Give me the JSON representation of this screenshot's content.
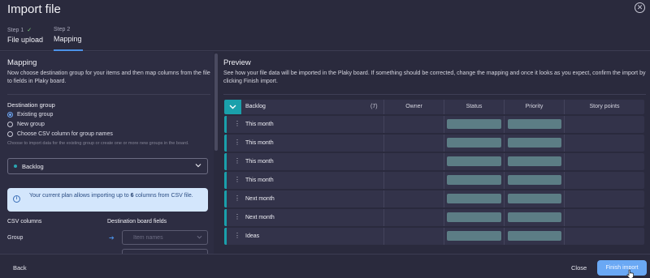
{
  "header": {
    "title": "Import file",
    "close_icon": "close-circle-icon"
  },
  "steps": [
    {
      "num": "Step 1",
      "label": "File upload",
      "done": true
    },
    {
      "num": "Step 2",
      "label": "Mapping",
      "active": true
    }
  ],
  "left": {
    "title": "Mapping",
    "description": "Now choose destination group for your items and then map columns from the file to fields in Plaky board.",
    "destination_title": "Destination group",
    "options": [
      {
        "label": "Existing group",
        "selected": true
      },
      {
        "label": "New group",
        "selected": false
      },
      {
        "label": "Choose CSV column for group names",
        "selected": false
      }
    ],
    "hint": "Choose to import data for the existing group or create one or more new groups in the board.",
    "selected_group": "Backlog",
    "info": {
      "prefix": "Your current plan allows importing up to ",
      "count": "6",
      "suffix": " columns from CSV file."
    },
    "csv_columns_header": "CSV columns",
    "destination_fields_header": "Destination board fields",
    "mapping": [
      {
        "csv": "Group",
        "placeholder": "Item names"
      }
    ]
  },
  "preview": {
    "title": "Preview",
    "description": "See how your file data will be imported in the Plaky board. If something should be corrected, change the mapping and once it looks as you expect, confirm the import by clicking Finish import.",
    "group_name": "Backlog",
    "count": "(7)",
    "columns": [
      "Owner",
      "Status",
      "Priority",
      "Story points"
    ],
    "rows": [
      "This month",
      "This month",
      "This month",
      "This month",
      "Next month",
      "Next month",
      "Ideas"
    ],
    "colors": {
      "accent": "#1aa0ab",
      "pill": "#5c7d85"
    }
  },
  "footer": {
    "back": "Back",
    "close": "Close",
    "finish": "Finish import"
  }
}
